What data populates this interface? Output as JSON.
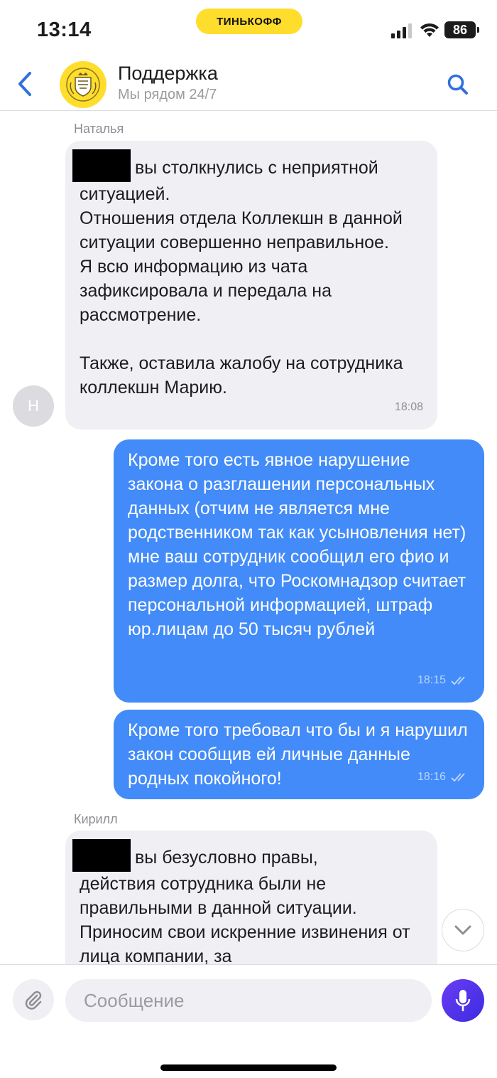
{
  "status_bar": {
    "time": "13:14",
    "carrier": "ТИНЬКОФФ",
    "battery": "86"
  },
  "header": {
    "title": "Поддержка",
    "subtitle": "Мы рядом 24/7",
    "back_icon": "chevron-left-icon",
    "search_icon": "search-icon"
  },
  "messages": [
    {
      "sender": "Наталья",
      "avatar_letter": "Н",
      "first_line": "вы столкнулись с неприятной",
      "text": "ситуацией.\nОтношения отдела Коллекшн в данной ситуации совершенно неправильное.\nЯ всю информацию из чата зафиксировала и передала на рассмотрение.\n\nТакже, оставила жалобу на сотрудника коллекшн Марию.",
      "time": "18:08"
    },
    {
      "text": "Кроме того есть явное нарушение закона о разглашении персональных данных (отчим не является мне родственником так как усыновления нет) мне ваш сотрудник сообщил его фио и размер долга, что Роскомнадзор считает персональной информацией, штраф юр.лицам до 50 тысяч рублей",
      "time": "18:15"
    },
    {
      "text": "Кроме того требовал что бы и я нарушил закон сообщив ей личные данные родных покойного!",
      "time": "18:16"
    },
    {
      "sender": "Кирилл",
      "first_line": "вы безусловно правы,",
      "text": "действия сотрудника были не правильными в данной ситуации. Приносим свои искренние извинения от лица компании, за"
    }
  ],
  "input": {
    "placeholder": "Сообщение"
  },
  "colors": {
    "brand": "#ffdd2d",
    "outgoing": "#428bf9",
    "incoming": "#efeff4",
    "accent": "#2f6fe0"
  }
}
